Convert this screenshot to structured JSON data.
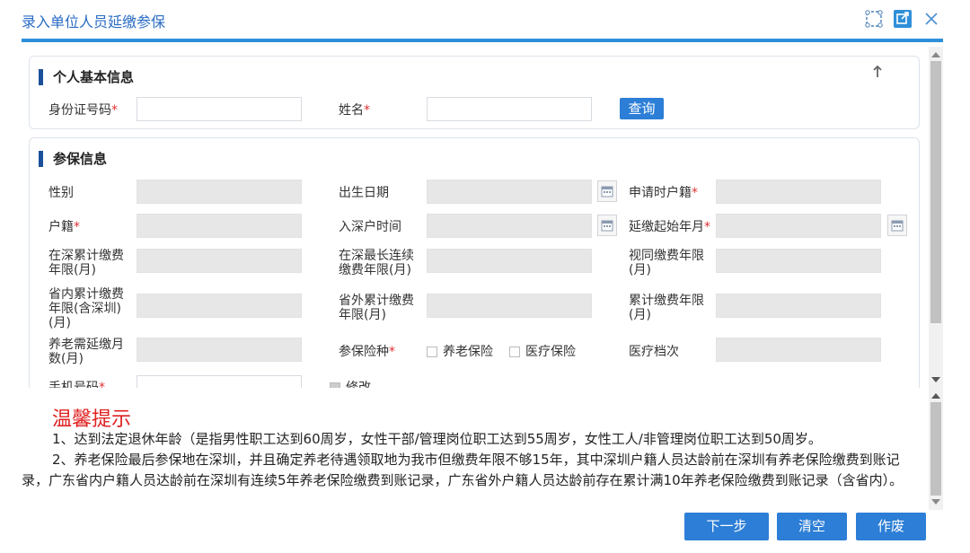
{
  "window": {
    "title": "录入单位人员延缴参保"
  },
  "basic_info": {
    "title": "个人基本信息",
    "id_label": "身份证号码",
    "name_label": "姓名",
    "query_button": "查询",
    "required_mark": "*"
  },
  "insurance_info": {
    "title": "参保信息",
    "gender_label": "性别",
    "birth_label": "出生日期",
    "apply_hukou_label": "申请时户籍",
    "hukou_label": "户籍",
    "enter_sz_label": "入深户时间",
    "start_month_label": "延缴起始年月",
    "sz_total_label": "在深累计缴费年限(月)",
    "sz_longest_label": "在深最长连续缴费年限(月)",
    "equiv_label": "视同缴费年限(月)",
    "prov_total_label": "省内累计缴费年限(含深圳)(月)",
    "outside_total_label": "省外累计缴费年限(月)",
    "total_label": "累计缴费年限(月)",
    "pension_need_label": "养老需延缴月数(月)",
    "types_label": "参保险种",
    "type_pension": "养老保险",
    "type_medical": "医疗保险",
    "medical_level_label": "医疗档次",
    "phone_label": "手机号码",
    "modify_label": "修改"
  },
  "tips": {
    "title": "温馨提示",
    "line1": "1、达到法定退休年龄（是指男性职工达到60周岁，女性干部/管理岗位职工达到55周岁，女性工人/非管理岗位职工达到50周岁。",
    "line2": "2、养老保险最后参保地在深圳，并且确定养老待遇领取地为我市但缴费年限不够15年，其中深圳户籍人员达龄前在深圳有养老保险缴费到账记录，广东省内户籍人员达龄前在深圳有连续5年养老保险缴费到账记录，广东省外户籍人员达龄前存在累计满10年养老保险缴费到账记录（含省内）。"
  },
  "footer": {
    "next": "下一步",
    "clear": "清空",
    "void": "作废"
  },
  "colors": {
    "accent": "#2c7ed6",
    "title": "#2a6cc4",
    "required": "#e03030",
    "tip_title": "#e02020"
  },
  "icons": [
    "fullscreen-icon",
    "popout-icon",
    "close-icon",
    "collapse-up-icon",
    "calendar-icon"
  ]
}
